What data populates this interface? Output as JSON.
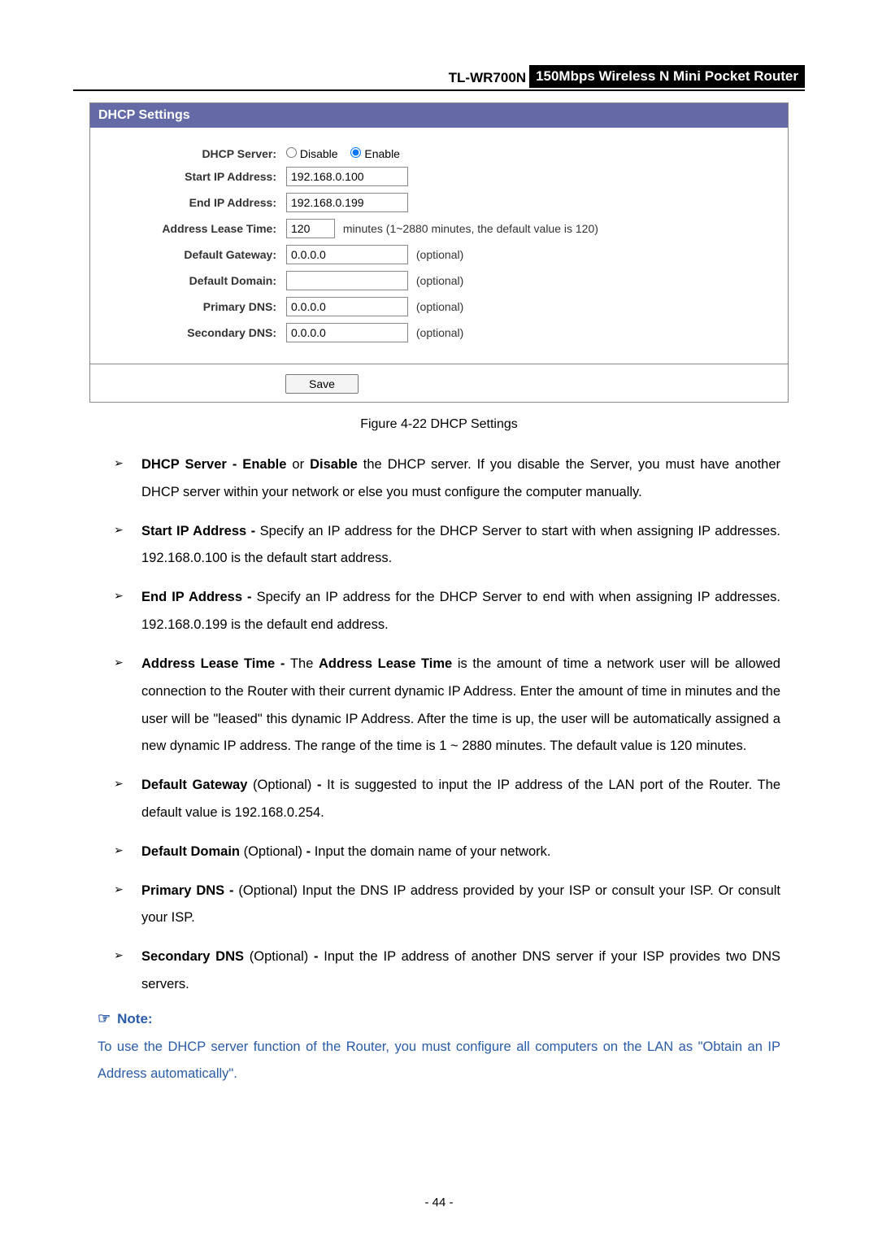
{
  "header": {
    "model": "TL-WR700N",
    "desc": "150Mbps Wireless N Mini Pocket Router"
  },
  "panel": {
    "title": "DHCP Settings",
    "fields": {
      "dhcp_server": {
        "label": "DHCP Server:",
        "opt_disable": "Disable",
        "opt_enable": "Enable"
      },
      "start_ip": {
        "label": "Start IP Address:",
        "value": "192.168.0.100"
      },
      "end_ip": {
        "label": "End IP Address:",
        "value": "192.168.0.199"
      },
      "lease": {
        "label": "Address Lease Time:",
        "value": "120",
        "hint": "minutes (1~2880 minutes, the default value is 120)"
      },
      "gateway": {
        "label": "Default Gateway:",
        "value": "0.0.0.0",
        "hint": "(optional)"
      },
      "domain": {
        "label": "Default Domain:",
        "value": "",
        "hint": "(optional)"
      },
      "pdns": {
        "label": "Primary DNS:",
        "value": "0.0.0.0",
        "hint": "(optional)"
      },
      "sdns": {
        "label": "Secondary DNS:",
        "value": "0.0.0.0",
        "hint": "(optional)"
      }
    },
    "save": "Save"
  },
  "caption": "Figure 4-22 DHCP Settings",
  "bullets": [
    {
      "b1": "DHCP Server - Enable",
      "t1": " or ",
      "b2": "Disable",
      "t2": " the DHCP server. If you disable the Server, you must have another DHCP server within your network or else you must configure the computer manually."
    },
    {
      "b1": "Start IP Address - ",
      "t1": "Specify an IP address for the DHCP Server to start with when assigning IP addresses. 192.168.0.100 is the default start address."
    },
    {
      "b1": "End IP Address - ",
      "t1": "Specify an IP address for the DHCP Server to end with when assigning IP addresses. 192.168.0.199 is the default end address."
    },
    {
      "b1": "Address Lease Time - ",
      "t1": "The ",
      "b2": "Address Lease Time",
      "t2": " is the amount of time a network user will be allowed connection to the Router with their current dynamic IP Address. Enter the amount of time in minutes and the user will be \"leased\" this dynamic IP Address. After the time is up, the user will be automatically assigned a new dynamic IP address. The range of the time is 1 ~ 2880 minutes. The default value is 120 minutes."
    },
    {
      "b1": "Default Gateway",
      "t1": " (Optional) ",
      "b2": "-",
      "t2": " It is suggested to input the IP address of the LAN port of the Router. The default value is 192.168.0.254."
    },
    {
      "b1": "Default Domain",
      "t1": " (Optional) ",
      "b2": "-",
      "t2": " Input the domain name of your network."
    },
    {
      "b1": "Primary DNS - ",
      "t1": "(Optional) Input the DNS IP address provided by your ISP or consult your ISP. Or consult your ISP."
    },
    {
      "b1": "Secondary DNS",
      "t1": " (Optional) ",
      "b2": "-",
      "t2": " Input the IP address of another DNS server if your ISP provides two DNS servers."
    }
  ],
  "note": {
    "head": "Note:",
    "body": "To use the DHCP server function of the Router, you must configure all computers on the LAN as \"Obtain an IP Address automatically\"."
  },
  "page_num": "- 44 -"
}
